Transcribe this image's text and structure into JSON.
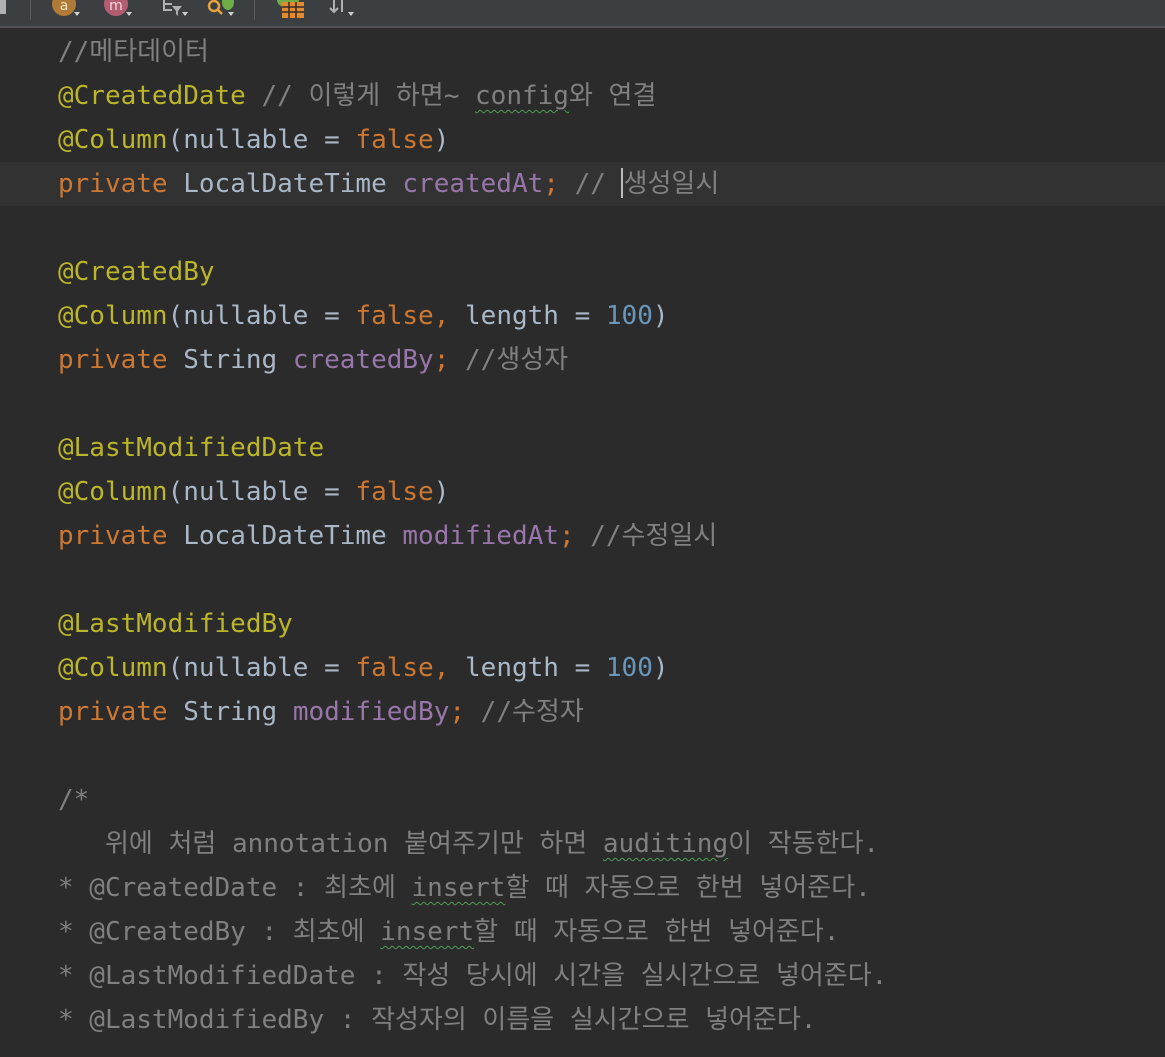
{
  "toolbar": {
    "icons": [
      "file-icon",
      "annotation-icon",
      "method-icon",
      "tree-filter-icon",
      "search-filter-icon",
      "table-icon",
      "sort-icon"
    ],
    "annotation_letter": "a",
    "method_letter": "m"
  },
  "colors": {
    "background": "#2b2b2b",
    "keyword": "#cc7832",
    "annotation": "#bbb529",
    "field": "#9876aa",
    "number": "#6897bb",
    "comment": "#808080",
    "text": "#a9b7c6"
  },
  "code": {
    "l1": {
      "comment": "//메타데이터"
    },
    "l2": {
      "annotation": "@CreatedDate",
      "comment_a": " // 이렇게 하면~ ",
      "comment_typo": "config",
      "comment_b": "와 연결"
    },
    "l3": {
      "annotation": "@Column",
      "open": "(nullable = ",
      "value": "false",
      "close": ")"
    },
    "l4": {
      "keyword": "private",
      "type": " LocalDateTime ",
      "field": "createdAt",
      "semi": ";",
      "comment_a": " // ",
      "comment_b": "생성일시"
    },
    "l5": {
      "annotation": "@CreatedBy"
    },
    "l6": {
      "annotation": "@Column",
      "open": "(nullable = ",
      "value": "false",
      "sep": ", ",
      "param": "length = ",
      "number": "100",
      "close": ")"
    },
    "l7": {
      "keyword": "private",
      "type": " String ",
      "field": "createdBy",
      "semi": ";",
      "comment": " //생성자"
    },
    "l8": {
      "annotation": "@LastModifiedDate"
    },
    "l9": {
      "annotation": "@Column",
      "open": "(nullable = ",
      "value": "false",
      "close": ")"
    },
    "l10": {
      "keyword": "private",
      "type": " LocalDateTime ",
      "field": "modifiedAt",
      "semi": ";",
      "comment": " //수정일시"
    },
    "l11": {
      "annotation": "@LastModifiedBy"
    },
    "l12": {
      "annotation": "@Column",
      "open": "(nullable = ",
      "value": "false",
      "sep": ", ",
      "param": "length = ",
      "number": "100",
      "close": ")"
    },
    "l13": {
      "keyword": "private",
      "type": " String ",
      "field": "modifiedBy",
      "semi": ";",
      "comment": " //수정자"
    },
    "l14": {
      "comment": "/*"
    },
    "l15": {
      "comment_a": "   위에 처럼 annotation 붙여주기만 하면 ",
      "comment_typo": "auditing",
      "comment_b": "이 작동한다."
    },
    "l16": {
      "comment_a": "* @CreatedDate : 최초에 ",
      "comment_typo": "insert",
      "comment_b": "할 때 자동으로 한번 넣어준다."
    },
    "l17": {
      "comment_a": "* @CreatedBy : 최초에 ",
      "comment_typo": "insert",
      "comment_b": "할 때 자동으로 한번 넣어준다."
    },
    "l18": {
      "comment": "* @LastModifiedDate : 작성 당시에 시간을 실시간으로 넣어준다."
    },
    "l19": {
      "comment": "* @LastModifiedBy : 작성자의 이름을 실시간으로 넣어준다."
    }
  }
}
